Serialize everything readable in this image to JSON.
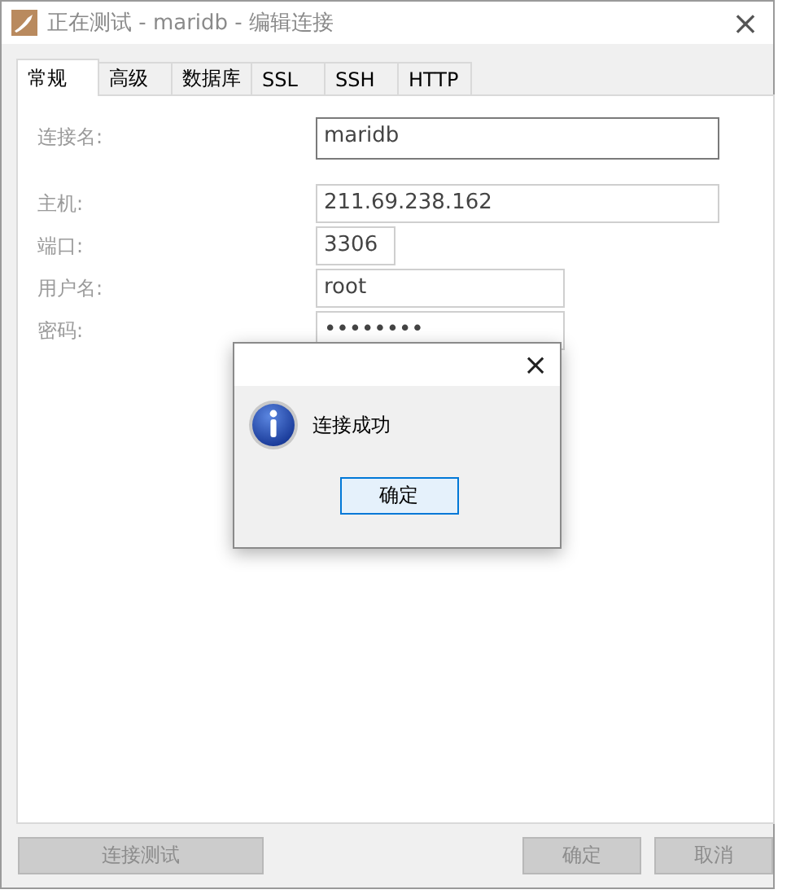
{
  "window": {
    "title": "正在测试 - maridb - 编辑连接",
    "close": "×"
  },
  "tabs": [
    {
      "label": "常规",
      "selected": true
    },
    {
      "label": "高级",
      "selected": false
    },
    {
      "label": "数据库",
      "selected": false
    },
    {
      "label": "SSL",
      "selected": false
    },
    {
      "label": "SSH",
      "selected": false
    },
    {
      "label": "HTTP",
      "selected": false
    }
  ],
  "fields": [
    {
      "label": "连接名:",
      "value": "maridb",
      "kind": "name"
    },
    {
      "label": "主机:",
      "value": "211.69.238.162",
      "kind": "wide"
    },
    {
      "label": "端口:",
      "value": "3306",
      "kind": "short"
    },
    {
      "label": "用户名:",
      "value": "root",
      "kind": "medium"
    },
    {
      "label": "密码:",
      "value": "••••••••",
      "kind": "medium"
    }
  ],
  "footer_buttons": [
    {
      "label": "连接测试",
      "disabled": true
    },
    {
      "label": "确定",
      "disabled": true
    },
    {
      "label": "取消",
      "disabled": true
    }
  ],
  "message_box": {
    "close": "×",
    "message": "连接成功",
    "button": "确定"
  }
}
